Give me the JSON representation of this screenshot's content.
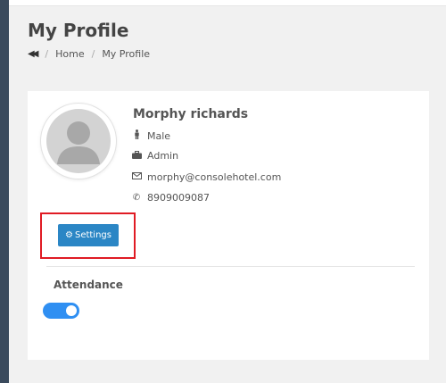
{
  "header": {
    "title": "My Profile",
    "breadcrumb": {
      "home": "Home",
      "current": "My Profile",
      "separator": "/"
    }
  },
  "profile": {
    "name": "Morphy richards",
    "gender": "Male",
    "role": "Admin",
    "email": "morphy@consolehotel.com",
    "phone": "8909009087"
  },
  "actions": {
    "settings_label": "Settings"
  },
  "attendance": {
    "label": "Attendance",
    "enabled": true
  },
  "colors": {
    "button": "#2b86c5",
    "toggle_on": "#2f8ff2",
    "highlight_box": "#e01b24"
  },
  "icons": {
    "back": "double-chevron-left-icon",
    "gender": "male-icon",
    "role": "briefcase-icon",
    "email": "envelope-icon",
    "phone": "phone-icon",
    "settings": "cogs-icon"
  }
}
